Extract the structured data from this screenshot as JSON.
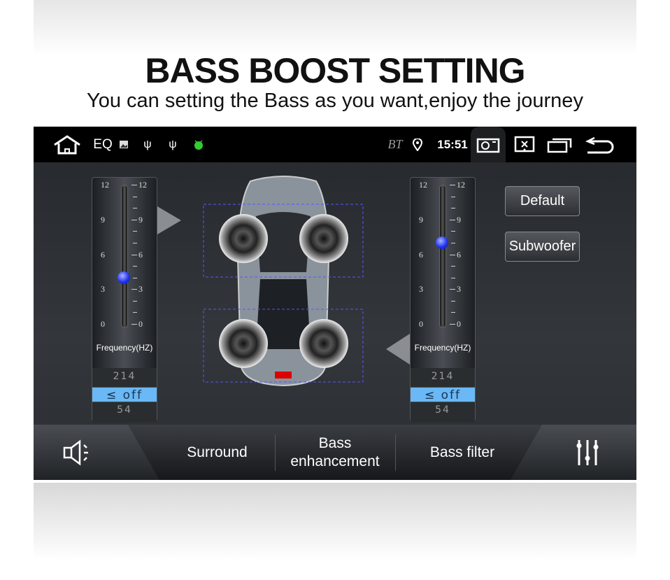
{
  "banner": {
    "title": "BASS BOOST SETTING",
    "subtitle": "You can setting the Bass as you want,enjoy the journey"
  },
  "status_bar": {
    "app": "EQ",
    "bt": "BT",
    "time": "15:51",
    "icons": [
      "home-icon",
      "image-icon",
      "usb-icon",
      "usb-icon",
      "android-icon",
      "bluetooth-icon",
      "location-icon",
      "screenshot-icon",
      "close-screen-icon",
      "recent-apps-icon",
      "back-icon"
    ]
  },
  "left_slider": {
    "scale_left": [
      "12",
      "9",
      "6",
      "3",
      "0"
    ],
    "scale_right": [
      "12",
      "9",
      "6",
      "3",
      "0"
    ],
    "value": 4,
    "max": 12,
    "label": "Frequency(HZ)",
    "options": [
      "214",
      "≤ off",
      "54"
    ],
    "selected": "≤ off"
  },
  "right_slider": {
    "scale_left": [
      "12",
      "9",
      "6",
      "3",
      "0"
    ],
    "scale_right": [
      "12",
      "9",
      "6",
      "3",
      "0"
    ],
    "value": 7,
    "max": 12,
    "label": "Frequency(HZ)",
    "options": [
      "214",
      "≤ off",
      "54"
    ],
    "selected": "≤ off"
  },
  "buttons": {
    "default": "Default",
    "subwoofer": "Subwoofer"
  },
  "tabs": {
    "sound": "sound-icon",
    "surround": "Surround",
    "bass_enh_1": "Bass",
    "bass_enh_2": "enhancement",
    "bass_filter": "Bass filter",
    "eq": "equalizer-icon"
  },
  "colors": {
    "accent": "#6ab8f5",
    "knob": "#2233ee"
  }
}
